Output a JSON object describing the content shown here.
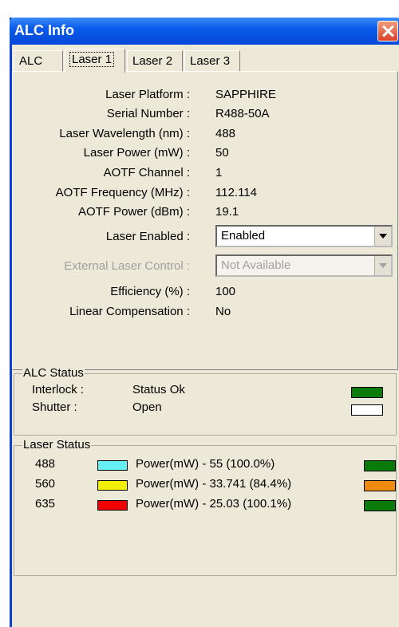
{
  "window": {
    "title": "ALC Info"
  },
  "tabs": [
    {
      "label": "ALC"
    },
    {
      "label": "Laser 1"
    },
    {
      "label": "Laser 2"
    },
    {
      "label": "Laser 3"
    }
  ],
  "fields": {
    "platform": {
      "label": "Laser Platform :",
      "value": "SAPPHIRE"
    },
    "serial": {
      "label": "Serial Number :",
      "value": "R488-50A"
    },
    "wavelength": {
      "label": "Laser Wavelength (nm) :",
      "value": "488"
    },
    "power": {
      "label": "Laser Power (mW) :",
      "value": "50"
    },
    "aotf_channel": {
      "label": "AOTF Channel :",
      "value": "1"
    },
    "aotf_freq": {
      "label": "AOTF Frequency (MHz) :",
      "value": "112.114"
    },
    "aotf_power": {
      "label": "AOTF Power (dBm) :",
      "value": "19.1"
    },
    "enabled": {
      "label": "Laser Enabled :",
      "value": "Enabled"
    },
    "ext_control": {
      "label": "External Laser Control :",
      "value": "Not Available"
    },
    "efficiency": {
      "label": "Efficiency (%) :",
      "value": "100"
    },
    "linear": {
      "label": "Linear Compensation :",
      "value": "No"
    }
  },
  "alc_status": {
    "title": "ALC Status",
    "rows": [
      {
        "label": "Interlock :",
        "value": "Status Ok",
        "color": "#0a7a0a"
      },
      {
        "label": "Shutter :",
        "value": "Open",
        "color": "#ffffff"
      }
    ]
  },
  "laser_status": {
    "title": "Laser Status",
    "rows": [
      {
        "wl": "488",
        "swatch": "#66f0f4",
        "text": "Power(mW) - 55 (100.0%)",
        "status": "#0a7a0a"
      },
      {
        "wl": "560",
        "swatch": "#f2f000",
        "text": "Power(mW) - 33.741 (84.4%)",
        "status": "#ee8a10"
      },
      {
        "wl": "635",
        "swatch": "#f00000",
        "text": "Power(mW) - 25.03 (100.1%)",
        "status": "#0a7a0a"
      }
    ]
  }
}
